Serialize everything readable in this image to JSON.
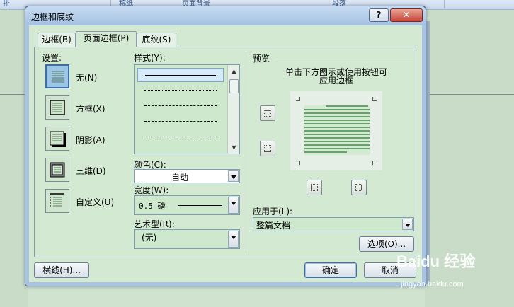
{
  "background": {
    "ribbon_groups": [
      "排",
      "稿纸",
      "页面背景",
      "段落"
    ]
  },
  "dialog": {
    "title": "边框和底纹",
    "help_button": "?",
    "close_button": "✕",
    "tabs": [
      {
        "label": "边框(B)",
        "active": false
      },
      {
        "label": "页面边框(P)",
        "active": true
      },
      {
        "label": "底纹(S)",
        "active": false
      }
    ],
    "settings": {
      "heading": "设置:",
      "items": [
        {
          "label": "无(N)",
          "icon": "setting-none-icon",
          "selected": true
        },
        {
          "label": "方框(X)",
          "icon": "setting-box-icon",
          "selected": false
        },
        {
          "label": "阴影(A)",
          "icon": "setting-shadow-icon",
          "selected": false
        },
        {
          "label": "三维(D)",
          "icon": "setting-3d-icon",
          "selected": false
        },
        {
          "label": "自定义(U)",
          "icon": "setting-custom-icon",
          "selected": false
        }
      ]
    },
    "style": {
      "heading": "样式(Y):",
      "lines": [
        "solid",
        "dotted",
        "dashed-small",
        "dashed",
        "dash-dot"
      ]
    },
    "color": {
      "label": "颜色(C):",
      "value": "自动"
    },
    "width": {
      "label": "宽度(W):",
      "value": "0.5 磅"
    },
    "art": {
      "label": "艺术型(R):",
      "value": "(无)"
    },
    "preview": {
      "heading": "预览",
      "hint_line1": "单击下方图示或使用按钮可",
      "hint_line2": "应用边框"
    },
    "apply_to": {
      "label": "应用于(L):",
      "value": "整篇文档"
    },
    "buttons": {
      "options": "选项(O)...",
      "horizontal_line": "横线(H)...",
      "ok": "确定",
      "cancel": "取消"
    },
    "colors": {
      "panel": "#d4e9d2",
      "selected_setting": "#9cc6e8",
      "preview_lines": "#66a36a"
    }
  },
  "watermark": {
    "brand": "Baidu 经验",
    "url": "jingyan.baidu.com"
  }
}
